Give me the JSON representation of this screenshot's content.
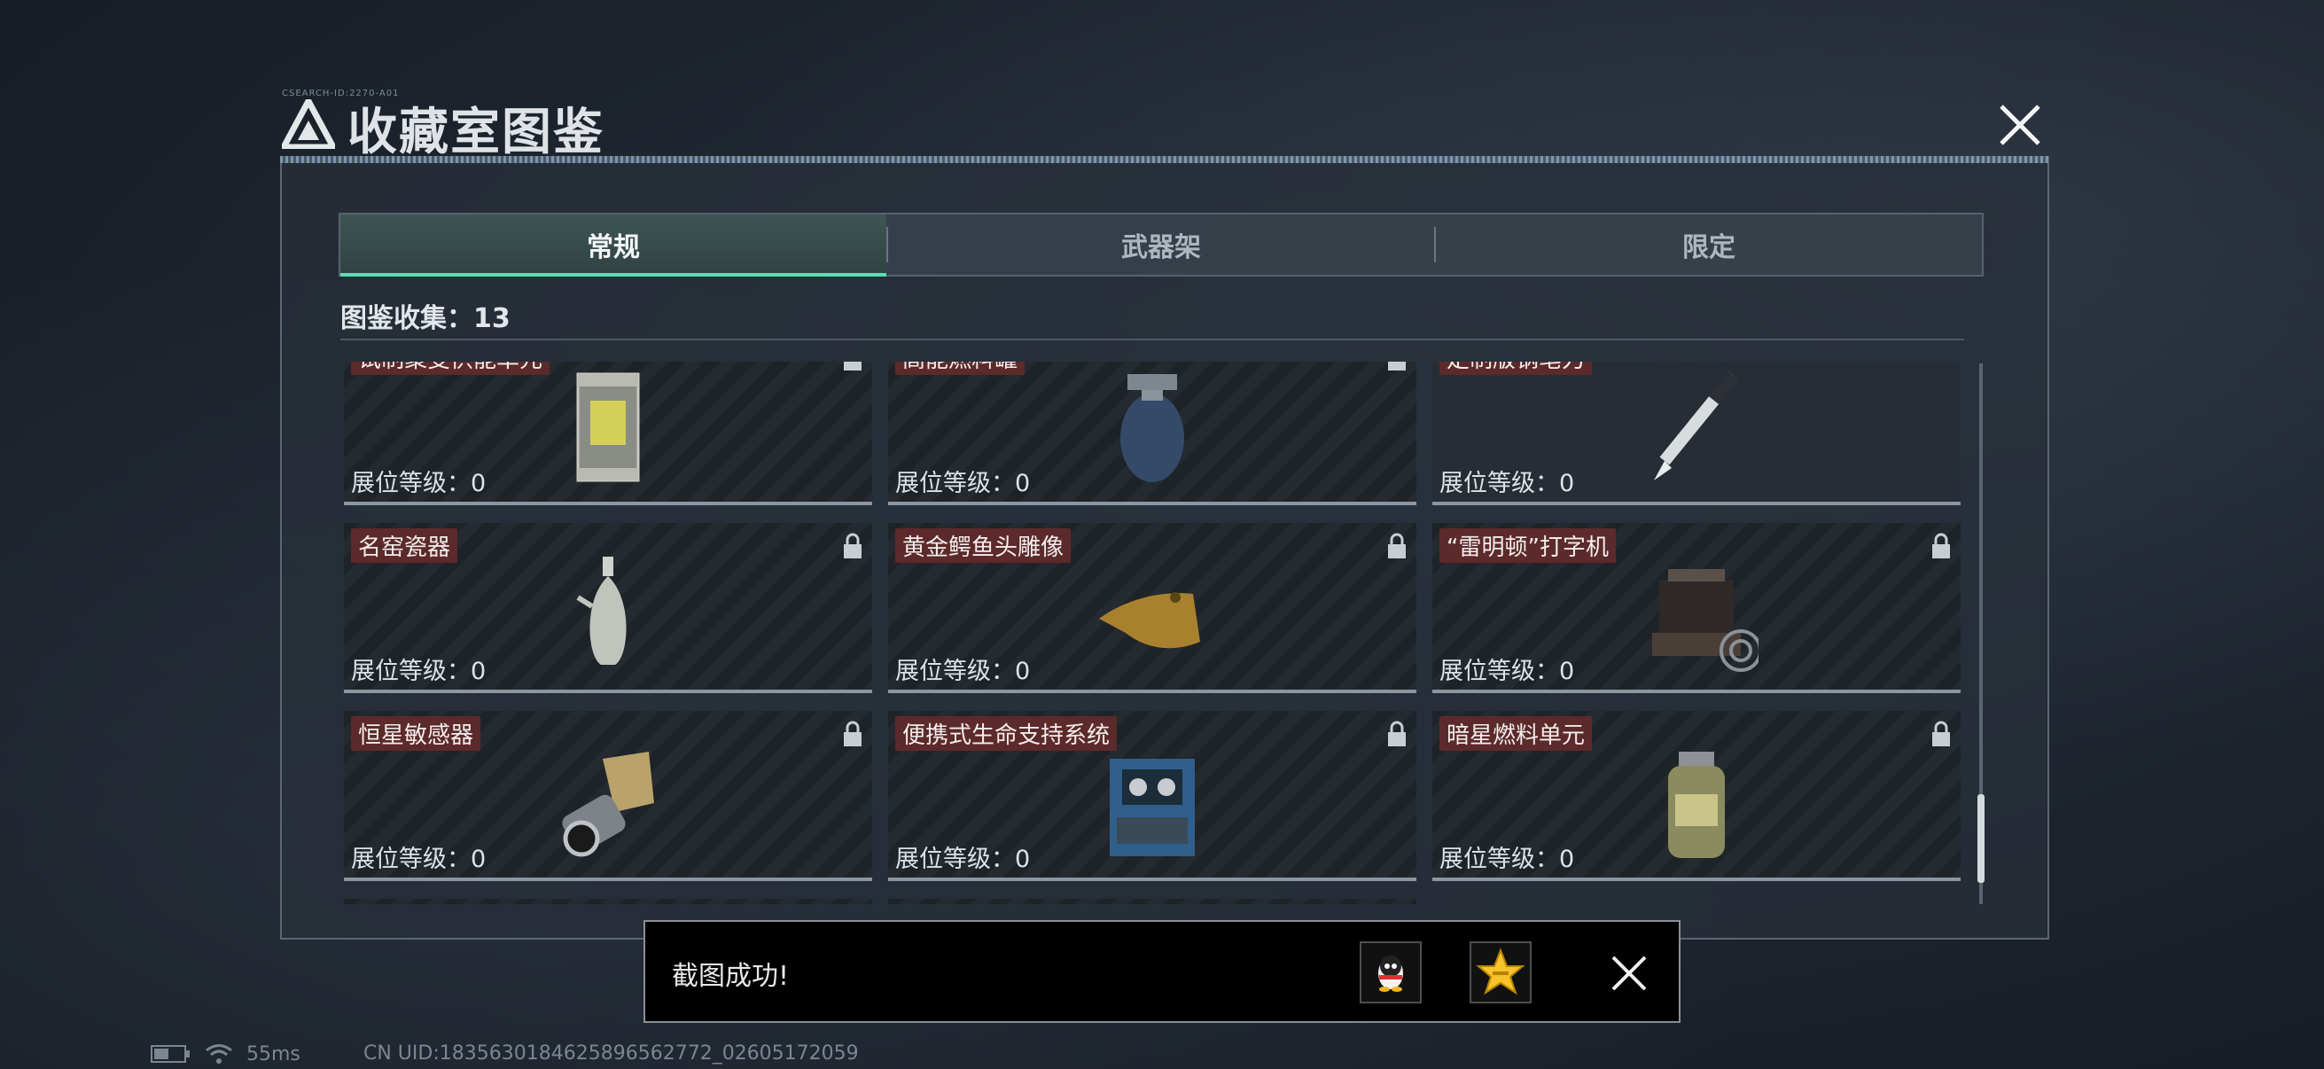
{
  "header": {
    "title": "收藏室图鉴",
    "deco_text": "CSEARCH-ID:2270-A01"
  },
  "tabs": [
    {
      "label": "常规",
      "active": true
    },
    {
      "label": "武器架",
      "active": false
    },
    {
      "label": "限定",
      "active": false
    }
  ],
  "collection": {
    "label": "图鉴收集：13"
  },
  "rows_partial_top": [
    {
      "name": "试制聚变供能单元",
      "level": "展位等级：0",
      "icon": "reactor-cell-icon"
    },
    {
      "name": "高能燃料罐",
      "level": "展位等级：0",
      "icon": "gas-canister-icon"
    },
    {
      "name": "定制版钢笔刀",
      "level": "展位等级：0",
      "icon": "pen-knife-icon"
    }
  ],
  "rows": [
    {
      "name": "名窑瓷器",
      "level": "展位等级：0",
      "icon": "porcelain-vase-icon"
    },
    {
      "name": "黄金鳄鱼头雕像",
      "level": "展位等级：0",
      "icon": "gold-crocodile-head-icon"
    },
    {
      "name": "“雷明顿”打字机",
      "level": "展位等级：0",
      "icon": "typewriter-icon"
    },
    {
      "name": "恒星敏感器",
      "level": "展位等级：0",
      "icon": "star-sensor-icon"
    },
    {
      "name": "便携式生命支持系统",
      "level": "展位等级：0",
      "icon": "life-support-icon"
    },
    {
      "name": "暗星燃料单元",
      "level": "展位等级：0",
      "icon": "fuel-cell-icon"
    }
  ],
  "toast": {
    "message": "截图成功!",
    "share_qq": "qq-icon",
    "share_qzone": "qzone-star-icon"
  },
  "status_bar": {
    "ping": "55ms",
    "uid": "CN UID:1835630184625896562772_02605172059"
  },
  "colors": {
    "accent": "#58e0b1",
    "label_bg": "#5c2a2a",
    "toast_bg": "#000000"
  }
}
